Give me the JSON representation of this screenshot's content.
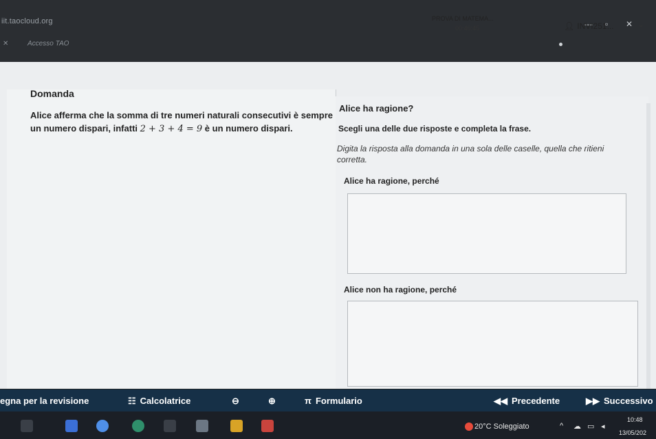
{
  "browser": {
    "url": "iit.taocloud.org",
    "tab_title": "Accesso TAO",
    "window_controls": [
      "—",
      "▫",
      "✕"
    ],
    "tab_close": "✕"
  },
  "header": {
    "test_title": "PROVA DI MATEMA...",
    "timer": "00:46:45",
    "user": "INVI251...",
    "user_icon": "person-icon"
  },
  "question": {
    "heading": "Domanda",
    "text_before": "Alice afferma che la somma di tre numeri naturali consecutivi è sempre un numero dispari, infatti ",
    "math": "2 + 3 + 4 = 9",
    "text_after": " è un numero dispari."
  },
  "answer": {
    "question": "Alice ha ragione?",
    "instruction": "Scegli una delle due risposte e completa la frase.",
    "subinstruction": "Digita la risposta alla domanda in una sola delle caselle, quella che ritieni corretta.",
    "option1_label": "Alice ha ragione, perché",
    "option2_label": "Alice non ha ragione, perché",
    "option1_value": "",
    "option2_value": ""
  },
  "toolbar": {
    "review_label": "egna per la revisione",
    "calculator_label": "Calcolatrice",
    "formulary_label": "Formulario",
    "prev_label": "Precedente",
    "next_label": "Successivo"
  },
  "taskbar": {
    "weather": "20°C Soleggiato",
    "time": "10:48",
    "date": "13/05/202"
  },
  "colors": {
    "toolbar_bg": "#163047",
    "page_bg": "#eceef0"
  }
}
